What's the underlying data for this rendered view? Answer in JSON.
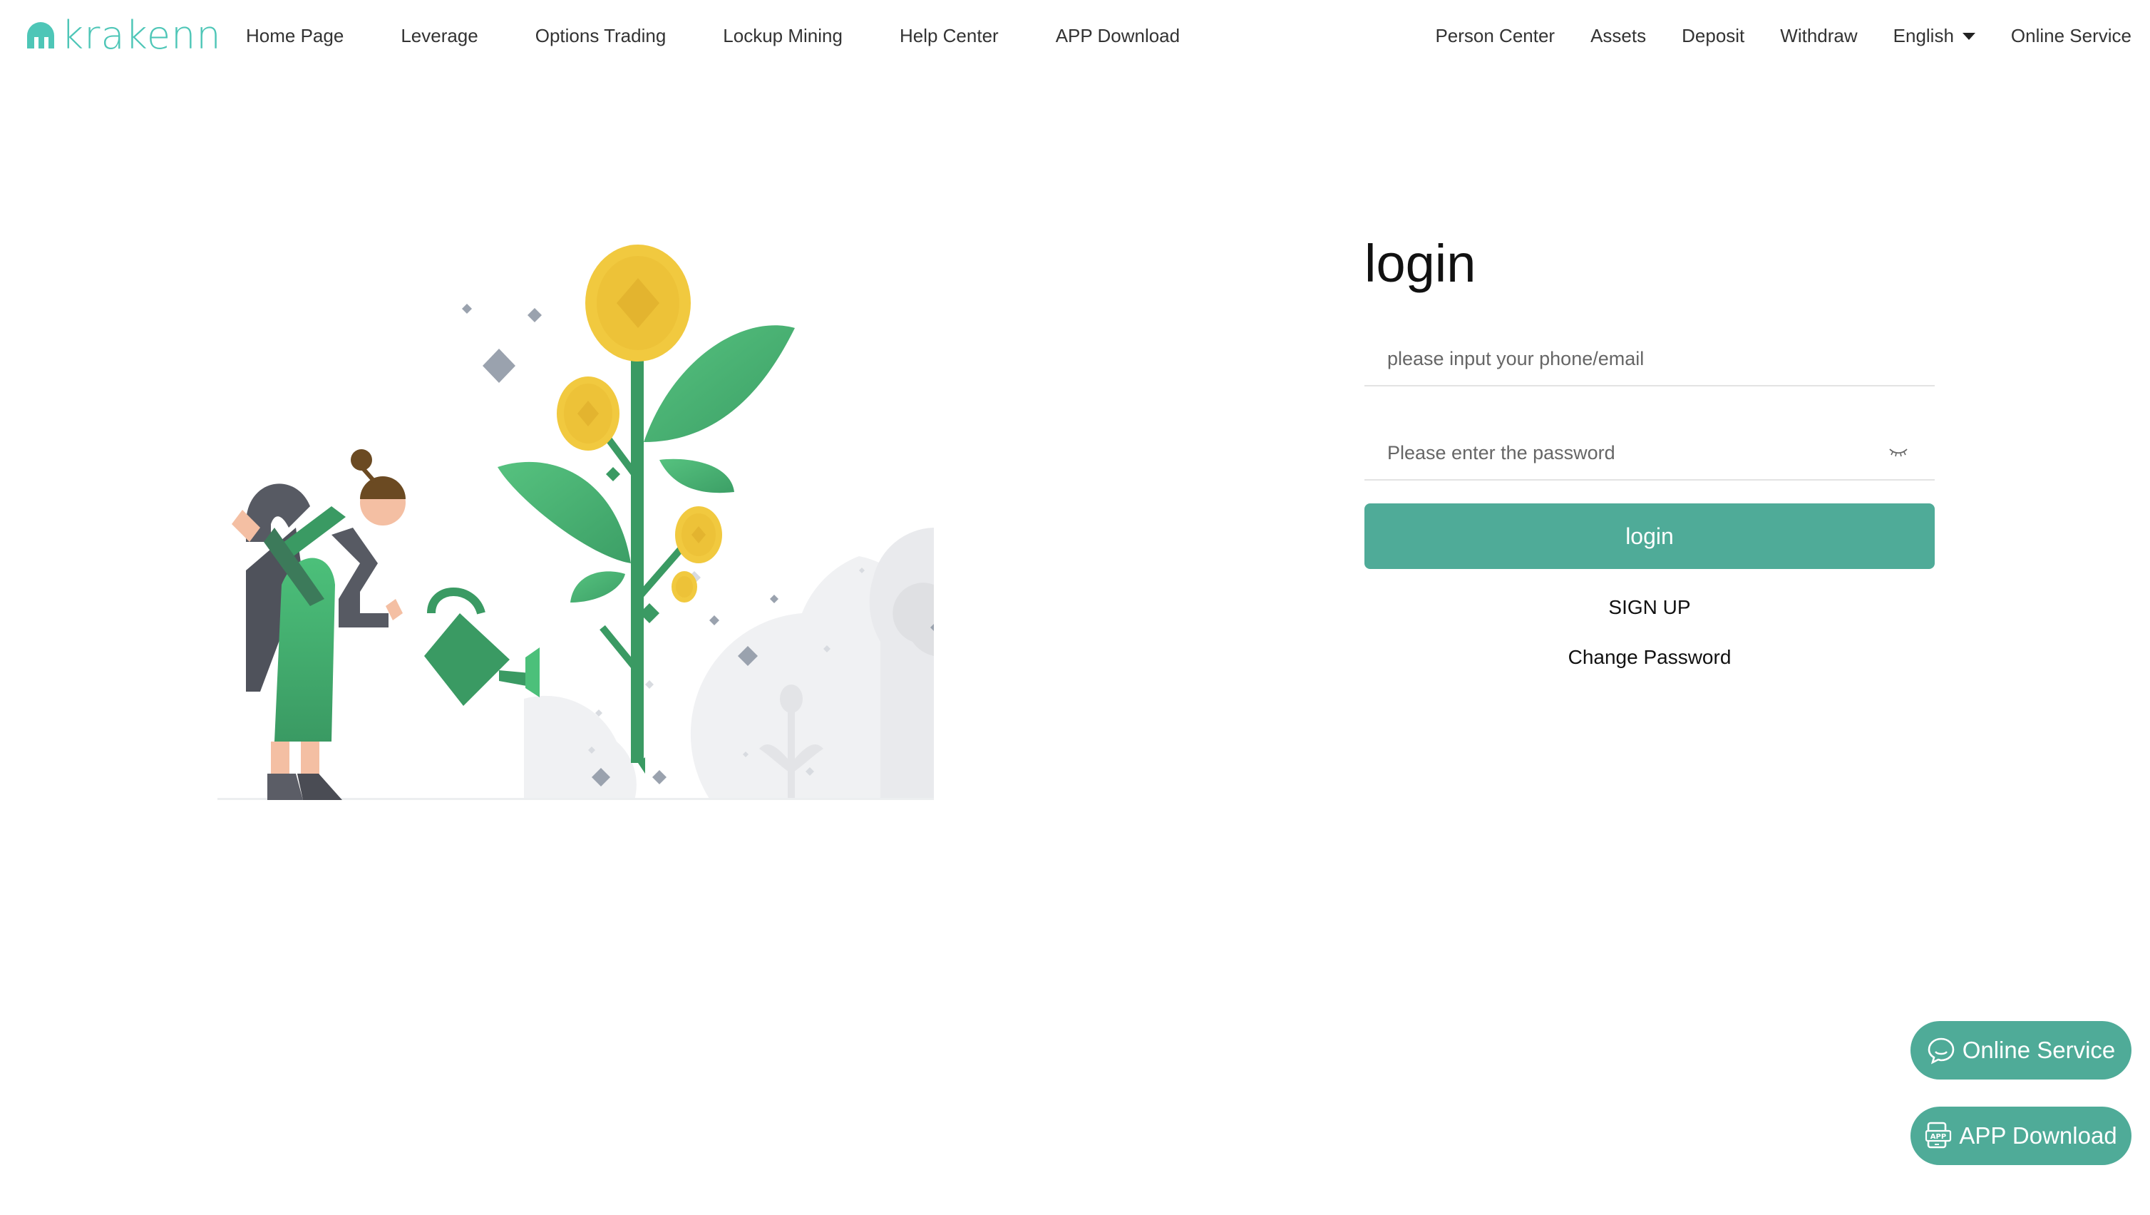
{
  "header": {
    "logo_text": "Krakenn",
    "nav_left": [
      "Home Page",
      "Leverage",
      "Options Trading",
      "Lockup Mining",
      "Help Center",
      "APP Download"
    ],
    "nav_right": {
      "person_center": "Person Center",
      "assets": "Assets",
      "deposit": "Deposit",
      "withdraw": "Withdraw",
      "language": "English",
      "online_service": "Online Service"
    }
  },
  "login": {
    "title": "login",
    "account_placeholder": "please input your phone/email",
    "password_placeholder": "Please enter the password",
    "submit_label": "login",
    "signup_label": "SIGN UP",
    "change_password_label": "Change Password"
  },
  "floating": {
    "online_service": "Online Service",
    "app_download": "APP Download"
  },
  "colors": {
    "brand": "#4ec6b7",
    "button": "#4fab98"
  },
  "icons": [
    "logo-icon",
    "chevron-down-icon",
    "eye-closed-icon",
    "chat-bubble-icon",
    "app-download-icon"
  ]
}
